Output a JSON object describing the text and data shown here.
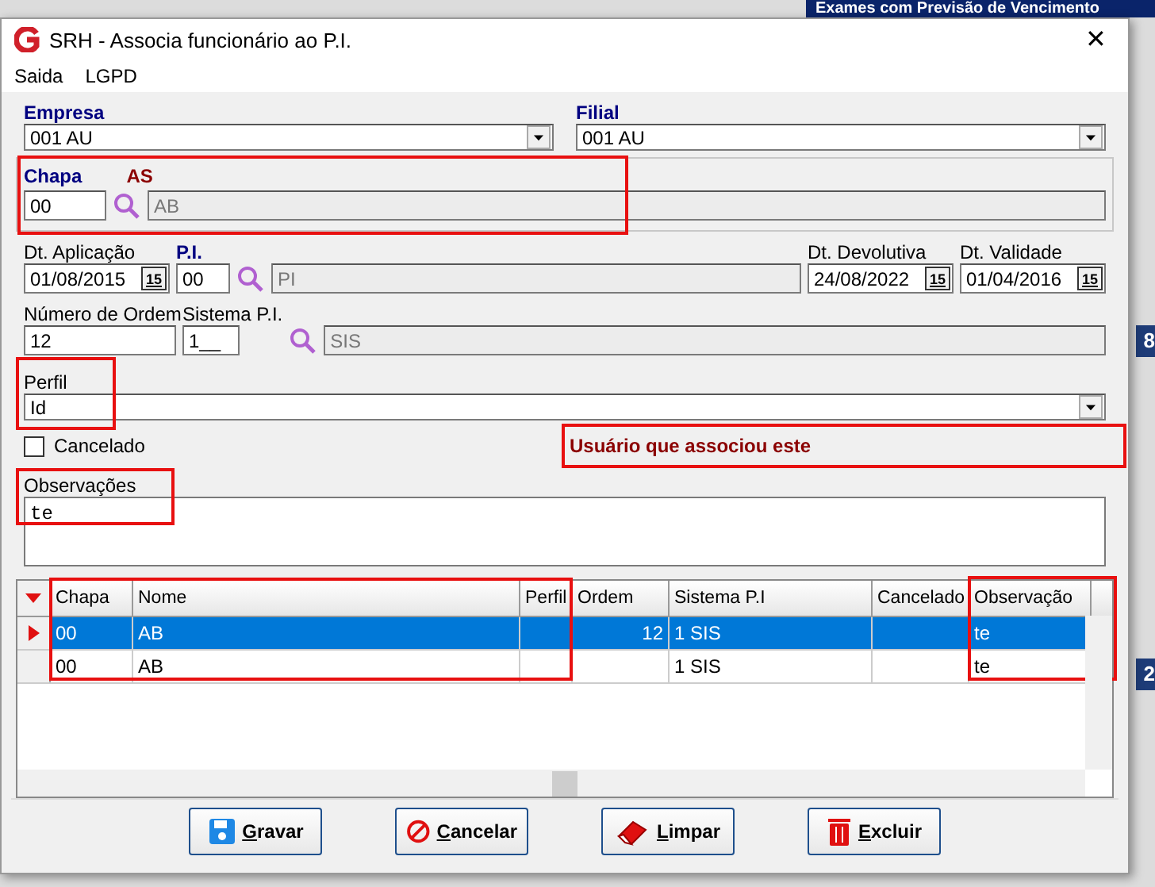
{
  "background_window": {
    "title": "Exames com Previsão de Vencimento",
    "cells": [
      "8",
      "2"
    ]
  },
  "window": {
    "title": "SRH - Associa funcionário ao P.I.",
    "close": "✕"
  },
  "menu": [
    {
      "label": "Saida"
    },
    {
      "label": "LGPD"
    }
  ],
  "empresa": {
    "label": "Empresa",
    "value": "001 AU"
  },
  "filial": {
    "label": "Filial",
    "value": "001 AU"
  },
  "chapa": {
    "label": "Chapa",
    "value": "00",
    "status": "AS",
    "name": "AB"
  },
  "dt_aplicacao": {
    "label": "Dt. Aplicação",
    "value": "01/08/2015",
    "calendar": "15"
  },
  "pi": {
    "label": "P.I.",
    "value": "00",
    "description": "PI"
  },
  "dt_devolutiva": {
    "label": "Dt. Devolutiva",
    "value": "24/08/2022",
    "calendar": "15"
  },
  "dt_validade": {
    "label": "Dt. Validade",
    "value": "01/04/2016",
    "calendar": "15"
  },
  "numero_ordem": {
    "label": "Número de Ordem",
    "value": "12"
  },
  "sistema_pi": {
    "label": "Sistema P.I.",
    "value": "1__",
    "description": "SIS"
  },
  "perfil": {
    "label": "Perfil",
    "value": "Id"
  },
  "cancelado": {
    "label": "Cancelado",
    "checked": false
  },
  "usuario": {
    "text": "Usuário que associou este"
  },
  "observacoes": {
    "label": "Observações",
    "value": "te"
  },
  "table": {
    "columns": [
      "Chapa",
      "Nome",
      "Perfil",
      "Ordem",
      "Sistema P.I",
      "Cancelado",
      "Observação"
    ],
    "rows": [
      {
        "selected": true,
        "cells": {
          "chapa": "00",
          "nome": "AB",
          "ordem": "12",
          "sistema": "1 SIS",
          "observacao": "te"
        }
      },
      {
        "selected": false,
        "cells": {
          "chapa": "00",
          "nome": "AB",
          "sistema": "1 SIS",
          "observacao": "te"
        }
      }
    ]
  },
  "buttons": [
    {
      "kind": "save",
      "label": "Gravar"
    },
    {
      "kind": "cancel",
      "label": "Cancelar"
    },
    {
      "kind": "clear",
      "label": "Limpar"
    },
    {
      "kind": "delete",
      "label": "Excluir"
    }
  ]
}
